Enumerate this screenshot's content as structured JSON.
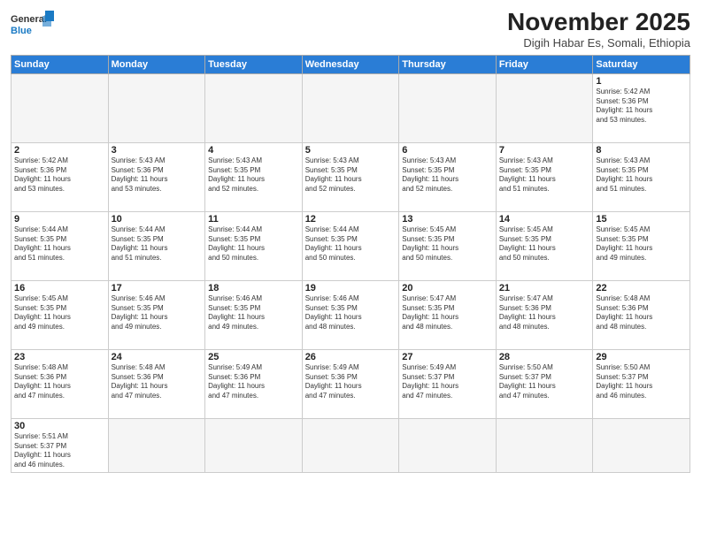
{
  "header": {
    "logo_general": "General",
    "logo_blue": "Blue",
    "month_title": "November 2025",
    "subtitle": "Digih Habar Es, Somali, Ethiopia"
  },
  "days_of_week": [
    "Sunday",
    "Monday",
    "Tuesday",
    "Wednesday",
    "Thursday",
    "Friday",
    "Saturday"
  ],
  "weeks": [
    [
      {
        "day": "",
        "info": ""
      },
      {
        "day": "",
        "info": ""
      },
      {
        "day": "",
        "info": ""
      },
      {
        "day": "",
        "info": ""
      },
      {
        "day": "",
        "info": ""
      },
      {
        "day": "",
        "info": ""
      },
      {
        "day": "1",
        "info": "Sunrise: 5:42 AM\nSunset: 5:36 PM\nDaylight: 11 hours\nand 53 minutes."
      }
    ],
    [
      {
        "day": "2",
        "info": "Sunrise: 5:42 AM\nSunset: 5:36 PM\nDaylight: 11 hours\nand 53 minutes."
      },
      {
        "day": "3",
        "info": "Sunrise: 5:43 AM\nSunset: 5:36 PM\nDaylight: 11 hours\nand 53 minutes."
      },
      {
        "day": "4",
        "info": "Sunrise: 5:43 AM\nSunset: 5:35 PM\nDaylight: 11 hours\nand 52 minutes."
      },
      {
        "day": "5",
        "info": "Sunrise: 5:43 AM\nSunset: 5:35 PM\nDaylight: 11 hours\nand 52 minutes."
      },
      {
        "day": "6",
        "info": "Sunrise: 5:43 AM\nSunset: 5:35 PM\nDaylight: 11 hours\nand 52 minutes."
      },
      {
        "day": "7",
        "info": "Sunrise: 5:43 AM\nSunset: 5:35 PM\nDaylight: 11 hours\nand 51 minutes."
      },
      {
        "day": "8",
        "info": "Sunrise: 5:43 AM\nSunset: 5:35 PM\nDaylight: 11 hours\nand 51 minutes."
      }
    ],
    [
      {
        "day": "9",
        "info": "Sunrise: 5:44 AM\nSunset: 5:35 PM\nDaylight: 11 hours\nand 51 minutes."
      },
      {
        "day": "10",
        "info": "Sunrise: 5:44 AM\nSunset: 5:35 PM\nDaylight: 11 hours\nand 51 minutes."
      },
      {
        "day": "11",
        "info": "Sunrise: 5:44 AM\nSunset: 5:35 PM\nDaylight: 11 hours\nand 50 minutes."
      },
      {
        "day": "12",
        "info": "Sunrise: 5:44 AM\nSunset: 5:35 PM\nDaylight: 11 hours\nand 50 minutes."
      },
      {
        "day": "13",
        "info": "Sunrise: 5:45 AM\nSunset: 5:35 PM\nDaylight: 11 hours\nand 50 minutes."
      },
      {
        "day": "14",
        "info": "Sunrise: 5:45 AM\nSunset: 5:35 PM\nDaylight: 11 hours\nand 50 minutes."
      },
      {
        "day": "15",
        "info": "Sunrise: 5:45 AM\nSunset: 5:35 PM\nDaylight: 11 hours\nand 49 minutes."
      }
    ],
    [
      {
        "day": "16",
        "info": "Sunrise: 5:45 AM\nSunset: 5:35 PM\nDaylight: 11 hours\nand 49 minutes."
      },
      {
        "day": "17",
        "info": "Sunrise: 5:46 AM\nSunset: 5:35 PM\nDaylight: 11 hours\nand 49 minutes."
      },
      {
        "day": "18",
        "info": "Sunrise: 5:46 AM\nSunset: 5:35 PM\nDaylight: 11 hours\nand 49 minutes."
      },
      {
        "day": "19",
        "info": "Sunrise: 5:46 AM\nSunset: 5:35 PM\nDaylight: 11 hours\nand 48 minutes."
      },
      {
        "day": "20",
        "info": "Sunrise: 5:47 AM\nSunset: 5:35 PM\nDaylight: 11 hours\nand 48 minutes."
      },
      {
        "day": "21",
        "info": "Sunrise: 5:47 AM\nSunset: 5:36 PM\nDaylight: 11 hours\nand 48 minutes."
      },
      {
        "day": "22",
        "info": "Sunrise: 5:48 AM\nSunset: 5:36 PM\nDaylight: 11 hours\nand 48 minutes."
      }
    ],
    [
      {
        "day": "23",
        "info": "Sunrise: 5:48 AM\nSunset: 5:36 PM\nDaylight: 11 hours\nand 47 minutes."
      },
      {
        "day": "24",
        "info": "Sunrise: 5:48 AM\nSunset: 5:36 PM\nDaylight: 11 hours\nand 47 minutes."
      },
      {
        "day": "25",
        "info": "Sunrise: 5:49 AM\nSunset: 5:36 PM\nDaylight: 11 hours\nand 47 minutes."
      },
      {
        "day": "26",
        "info": "Sunrise: 5:49 AM\nSunset: 5:36 PM\nDaylight: 11 hours\nand 47 minutes."
      },
      {
        "day": "27",
        "info": "Sunrise: 5:49 AM\nSunset: 5:37 PM\nDaylight: 11 hours\nand 47 minutes."
      },
      {
        "day": "28",
        "info": "Sunrise: 5:50 AM\nSunset: 5:37 PM\nDaylight: 11 hours\nand 47 minutes."
      },
      {
        "day": "29",
        "info": "Sunrise: 5:50 AM\nSunset: 5:37 PM\nDaylight: 11 hours\nand 46 minutes."
      }
    ],
    [
      {
        "day": "30",
        "info": "Sunrise: 5:51 AM\nSunset: 5:37 PM\nDaylight: 11 hours\nand 46 minutes."
      },
      {
        "day": "",
        "info": ""
      },
      {
        "day": "",
        "info": ""
      },
      {
        "day": "",
        "info": ""
      },
      {
        "day": "",
        "info": ""
      },
      {
        "day": "",
        "info": ""
      },
      {
        "day": "",
        "info": ""
      }
    ]
  ]
}
